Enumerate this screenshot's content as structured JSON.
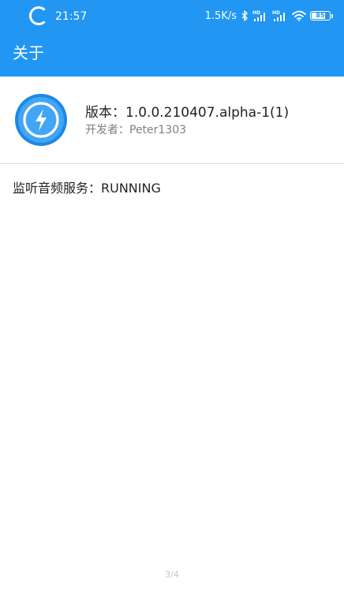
{
  "status_bar": {
    "time": "21:57",
    "network_speed": "1.5K/s",
    "battery_level": 85,
    "battery_text": "85",
    "icons": [
      "loading-spinner-icon",
      "bluetooth-icon",
      "signal-hd-icon",
      "signal-hd-icon",
      "wifi-icon",
      "battery-icon"
    ]
  },
  "toolbar": {
    "title": "关于"
  },
  "app_info": {
    "logo_icon": "lightning-bolt-icon",
    "version": "版本：1.0.0.210407.alpha-1(1)",
    "developer": "开发者：Peter1303"
  },
  "service": {
    "status": "监听音频服务：RUNNING"
  },
  "page_indicator": "3/4",
  "colors": {
    "primary": "#2196f3",
    "logo_dark": "#1e88e5",
    "text_primary": "#222222",
    "text_secondary": "#808080",
    "divider": "#dcdcdc"
  }
}
